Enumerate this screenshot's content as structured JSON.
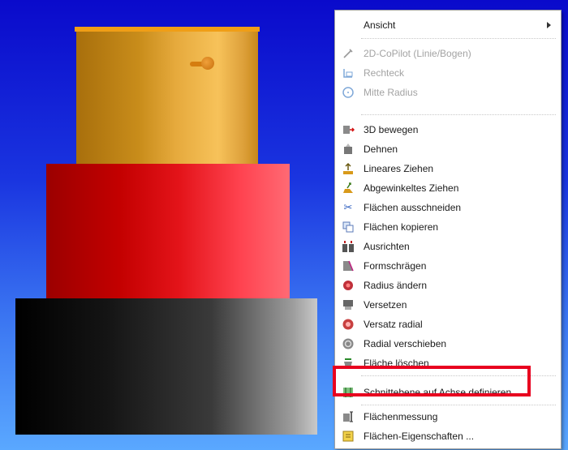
{
  "menu": {
    "header": {
      "label": "Ansicht",
      "icon": ""
    },
    "group_draw": [
      {
        "label": "2D-CoPilot (Linie/Bogen)",
        "icon": "pencil-icon",
        "enabled": false
      },
      {
        "label": "Rechteck",
        "icon": "rectangle-icon",
        "enabled": false
      },
      {
        "label": "Mitte Radius",
        "icon": "circle-icon",
        "enabled": false
      }
    ],
    "group_modify": [
      {
        "label": "3D bewegen",
        "icon": "move-3d-icon"
      },
      {
        "label": "Dehnen",
        "icon": "stretch-icon"
      },
      {
        "label": "Lineares Ziehen",
        "icon": "linear-pull-icon"
      },
      {
        "label": "Abgewinkeltes Ziehen",
        "icon": "angled-pull-icon"
      },
      {
        "label": "Flächen ausschneiden",
        "icon": "scissors-icon"
      },
      {
        "label": "Flächen kopieren",
        "icon": "copy-faces-icon"
      },
      {
        "label": "Ausrichten",
        "icon": "align-icon"
      },
      {
        "label": "Formschrägen",
        "icon": "draft-icon"
      },
      {
        "label": "Radius ändern",
        "icon": "change-radius-icon"
      },
      {
        "label": "Versetzen",
        "icon": "offset-icon"
      },
      {
        "label": "Versatz radial",
        "icon": "radial-offset-icon"
      },
      {
        "label": "Radial verschieben",
        "icon": "radial-move-icon"
      },
      {
        "label": "Fläche löschen",
        "icon": "delete-face-icon"
      }
    ],
    "section_plane": {
      "label": "Schnittebene auf Achse definieren",
      "icon": "section-plane-icon"
    },
    "group_measure": [
      {
        "label": "Flächenmessung",
        "icon": "face-measure-icon"
      },
      {
        "label": "Flächen-Eigenschaften ...",
        "icon": "face-properties-icon"
      }
    ]
  },
  "colors": {
    "highlight_box": "#e8001f",
    "background_top": "#0a0acb",
    "background_bottom": "#5aa8ff",
    "top_cylinder": "#e6aa3d",
    "middle_cylinder": "#e4141a",
    "bottom_cylinder": "#3a3a3a"
  }
}
